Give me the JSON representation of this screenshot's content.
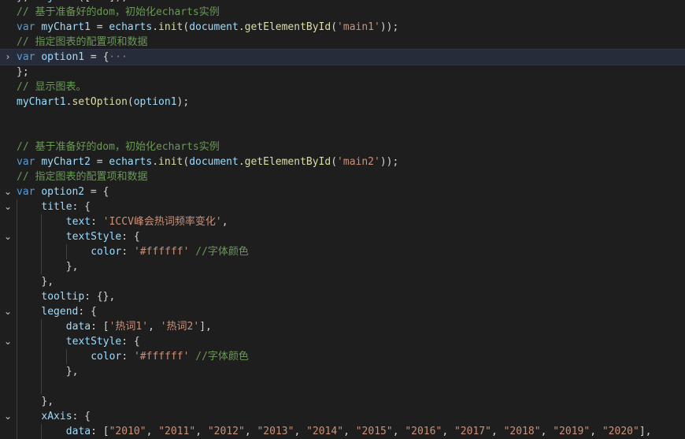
{
  "editor": {
    "language": "javascript",
    "theme_colors": {
      "background": "#1e1e1e",
      "keyword": "#569cd6",
      "variable": "#9cdcfe",
      "function": "#dcdcaa",
      "string": "#ce9178",
      "comment": "#6a9955",
      "punctuation": "#d4d4d4"
    },
    "fold_icons": {
      "expanded": "⌄",
      "collapsed": "›"
    },
    "lines": [
      {
        "indent": 0,
        "fold": "none",
        "tokens": [
          [
            "pun",
            "}"
          ],
          [
            "pun",
            ","
          ],
          [
            "pun",
            " "
          ],
          [
            "var",
            "obj"
          ],
          [
            "pun",
            "."
          ],
          [
            "fn",
            "set"
          ],
          [
            "pun",
            "(["
          ],
          [
            "str",
            "'x'"
          ],
          [
            "pun",
            "]);"
          ]
        ]
      },
      {
        "indent": 0,
        "fold": "none",
        "tokens": [
          [
            "cmt",
            "// 基于准备好的dom，初始化echarts实例"
          ]
        ]
      },
      {
        "indent": 0,
        "fold": "none",
        "tokens": [
          [
            "kw",
            "var"
          ],
          [
            "pun",
            " "
          ],
          [
            "var",
            "myChart1"
          ],
          [
            "pun",
            " = "
          ],
          [
            "var",
            "echarts"
          ],
          [
            "pun",
            "."
          ],
          [
            "fn",
            "init"
          ],
          [
            "pun",
            "("
          ],
          [
            "var",
            "document"
          ],
          [
            "pun",
            "."
          ],
          [
            "fn",
            "getElementById"
          ],
          [
            "pun",
            "("
          ],
          [
            "str",
            "'main1'"
          ],
          [
            "pun",
            "));"
          ]
        ]
      },
      {
        "indent": 0,
        "fold": "none",
        "tokens": [
          [
            "cmt",
            "// 指定图表的配置项和数据"
          ]
        ]
      },
      {
        "indent": 0,
        "fold": "collapsed",
        "current": true,
        "tokens": [
          [
            "kw",
            "var"
          ],
          [
            "pun",
            " "
          ],
          [
            "var",
            "option1"
          ],
          [
            "pun",
            " = {"
          ],
          [
            "ell",
            "···"
          ]
        ]
      },
      {
        "indent": 0,
        "fold": "none",
        "tokens": [
          [
            "pun",
            "};"
          ]
        ]
      },
      {
        "indent": 0,
        "fold": "none",
        "tokens": [
          [
            "cmt",
            "// 显示图表。"
          ]
        ]
      },
      {
        "indent": 0,
        "fold": "none",
        "tokens": [
          [
            "var",
            "myChart1"
          ],
          [
            "pun",
            "."
          ],
          [
            "fn",
            "setOption"
          ],
          [
            "pun",
            "("
          ],
          [
            "var",
            "option1"
          ],
          [
            "pun",
            ");"
          ]
        ]
      },
      {
        "indent": 0,
        "fold": "none",
        "tokens": []
      },
      {
        "indent": 0,
        "fold": "none",
        "tokens": []
      },
      {
        "indent": 0,
        "fold": "none",
        "tokens": [
          [
            "cmt",
            "// 基于准备好的dom，初始化echarts实例"
          ]
        ]
      },
      {
        "indent": 0,
        "fold": "none",
        "tokens": [
          [
            "kw",
            "var"
          ],
          [
            "pun",
            " "
          ],
          [
            "var",
            "myChart2"
          ],
          [
            "pun",
            " = "
          ],
          [
            "var",
            "echarts"
          ],
          [
            "pun",
            "."
          ],
          [
            "fn",
            "init"
          ],
          [
            "pun",
            "("
          ],
          [
            "var",
            "document"
          ],
          [
            "pun",
            "."
          ],
          [
            "fn",
            "getElementById"
          ],
          [
            "pun",
            "("
          ],
          [
            "str",
            "'main2'"
          ],
          [
            "pun",
            "));"
          ]
        ]
      },
      {
        "indent": 0,
        "fold": "none",
        "tokens": [
          [
            "cmt",
            "// 指定图表的配置项和数据"
          ]
        ]
      },
      {
        "indent": 0,
        "fold": "expanded",
        "tokens": [
          [
            "kw",
            "var"
          ],
          [
            "pun",
            " "
          ],
          [
            "var",
            "option2"
          ],
          [
            "pun",
            " = {"
          ]
        ]
      },
      {
        "indent": 1,
        "fold": "expanded",
        "tokens": [
          [
            "var",
            "title"
          ],
          [
            "pun",
            ": {"
          ]
        ]
      },
      {
        "indent": 2,
        "fold": "none",
        "tokens": [
          [
            "var",
            "text"
          ],
          [
            "pun",
            ": "
          ],
          [
            "str",
            "'ICCV峰会热词频率变化'"
          ],
          [
            "pun",
            ","
          ]
        ]
      },
      {
        "indent": 2,
        "fold": "expanded",
        "tokens": [
          [
            "var",
            "textStyle"
          ],
          [
            "pun",
            ": {"
          ]
        ]
      },
      {
        "indent": 3,
        "fold": "none",
        "tokens": [
          [
            "var",
            "color"
          ],
          [
            "pun",
            ": "
          ],
          [
            "str",
            "'#ffffff'"
          ],
          [
            "pun",
            " "
          ],
          [
            "cmt",
            "//字体颜色"
          ]
        ]
      },
      {
        "indent": 2,
        "fold": "none",
        "tokens": [
          [
            "pun",
            "},"
          ]
        ]
      },
      {
        "indent": 1,
        "fold": "none",
        "tokens": [
          [
            "pun",
            "},"
          ]
        ]
      },
      {
        "indent": 1,
        "fold": "none",
        "tokens": [
          [
            "var",
            "tooltip"
          ],
          [
            "pun",
            ": {},"
          ]
        ]
      },
      {
        "indent": 1,
        "fold": "expanded",
        "tokens": [
          [
            "var",
            "legend"
          ],
          [
            "pun",
            ": {"
          ]
        ]
      },
      {
        "indent": 2,
        "fold": "none",
        "tokens": [
          [
            "var",
            "data"
          ],
          [
            "pun",
            ": ["
          ],
          [
            "str",
            "'热词1'"
          ],
          [
            "pun",
            ", "
          ],
          [
            "str",
            "'热词2'"
          ],
          [
            "pun",
            "],"
          ]
        ]
      },
      {
        "indent": 2,
        "fold": "expanded",
        "tokens": [
          [
            "var",
            "textStyle"
          ],
          [
            "pun",
            ": {"
          ]
        ]
      },
      {
        "indent": 3,
        "fold": "none",
        "tokens": [
          [
            "var",
            "color"
          ],
          [
            "pun",
            ": "
          ],
          [
            "str",
            "'#ffffff'"
          ],
          [
            "pun",
            " "
          ],
          [
            "cmt",
            "//字体颜色"
          ]
        ]
      },
      {
        "indent": 2,
        "fold": "none",
        "tokens": [
          [
            "pun",
            "},"
          ]
        ]
      },
      {
        "indent": 2,
        "fold": "none",
        "tokens": []
      },
      {
        "indent": 1,
        "fold": "none",
        "tokens": [
          [
            "pun",
            "},"
          ]
        ]
      },
      {
        "indent": 1,
        "fold": "expanded",
        "tokens": [
          [
            "var",
            "xAxis"
          ],
          [
            "pun",
            ": {"
          ]
        ]
      },
      {
        "indent": 2,
        "fold": "none",
        "tokens": [
          [
            "var",
            "data"
          ],
          [
            "pun",
            ": ["
          ],
          [
            "str",
            "\"2010\""
          ],
          [
            "pun",
            ", "
          ],
          [
            "str",
            "\"2011\""
          ],
          [
            "pun",
            ", "
          ],
          [
            "str",
            "\"2012\""
          ],
          [
            "pun",
            ", "
          ],
          [
            "str",
            "\"2013\""
          ],
          [
            "pun",
            ", "
          ],
          [
            "str",
            "\"2014\""
          ],
          [
            "pun",
            ", "
          ],
          [
            "str",
            "\"2015\""
          ],
          [
            "pun",
            ", "
          ],
          [
            "str",
            "\"2016\""
          ],
          [
            "pun",
            ", "
          ],
          [
            "str",
            "\"2017\""
          ],
          [
            "pun",
            ", "
          ],
          [
            "str",
            "\"2018\""
          ],
          [
            "pun",
            ", "
          ],
          [
            "str",
            "\"2019\""
          ],
          [
            "pun",
            ", "
          ],
          [
            "str",
            "\"2020\""
          ],
          [
            "pun",
            "],"
          ]
        ]
      }
    ]
  }
}
